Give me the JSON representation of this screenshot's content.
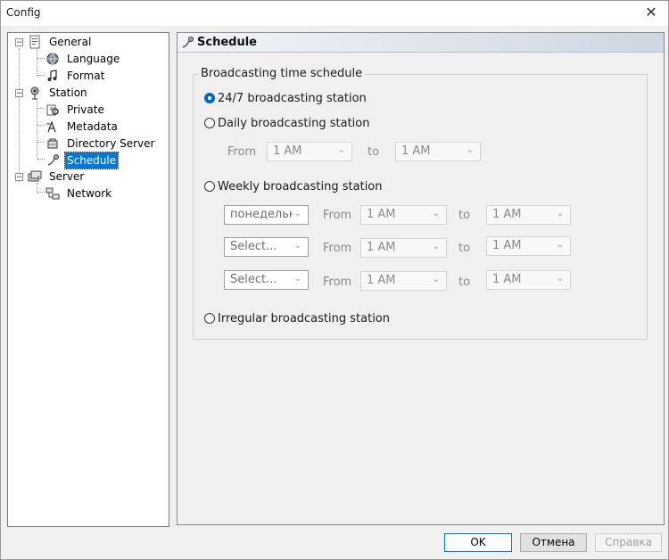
{
  "window": {
    "title": "Config",
    "close_glyph": "✕"
  },
  "tree": {
    "general": {
      "label": "General",
      "expander": "−",
      "icon": "settings-page-icon"
    },
    "language": {
      "label": "Language",
      "icon": "globe-icon"
    },
    "format": {
      "label": "Format",
      "icon": "music-note-icon"
    },
    "station": {
      "label": "Station",
      "expander": "−",
      "icon": "radio-station-icon"
    },
    "private": {
      "label": "Private",
      "icon": "private-key-icon"
    },
    "metadata": {
      "label": "Metadata",
      "icon": "metadata-icon"
    },
    "directory_server": {
      "label": "Directory Server",
      "icon": "directory-server-icon"
    },
    "schedule": {
      "label": "Schedule",
      "icon": "schedule-icon",
      "selected": true
    },
    "server": {
      "label": "Server",
      "expander": "−",
      "icon": "server-icon"
    },
    "network": {
      "label": "Network",
      "icon": "network-icon"
    }
  },
  "panel": {
    "title": "Schedule",
    "icon": "schedule-icon"
  },
  "schedule": {
    "group_label": "Broadcasting time schedule",
    "options": {
      "always": {
        "label": "24/7 broadcasting station",
        "checked": true
      },
      "daily": {
        "label": "Daily broadcasting station",
        "checked": false
      },
      "weekly": {
        "label": "Weekly broadcasting station",
        "checked": false
      },
      "irregular": {
        "label": "Irregular broadcasting station",
        "checked": false
      }
    },
    "daily_row": {
      "from_label": "From",
      "from_value": "1 AM",
      "to_label": "to",
      "to_value": "1 AM"
    },
    "weekly_rows": [
      {
        "day": "понедельн",
        "from_label": "From",
        "from_value": "1 AM",
        "to_label": "to",
        "to_value": "1 AM"
      },
      {
        "day": "Select...",
        "from_label": "From",
        "from_value": "1 AM",
        "to_label": "to",
        "to_value": "1 AM"
      },
      {
        "day": "Select...",
        "from_label": "From",
        "from_value": "1 AM",
        "to_label": "to",
        "to_value": "1 AM"
      }
    ]
  },
  "buttons": {
    "ok": "OK",
    "cancel": "Отмена",
    "help": "Справка"
  },
  "colors": {
    "selection": "#0078d7",
    "radio_checked": "#0067c0"
  }
}
